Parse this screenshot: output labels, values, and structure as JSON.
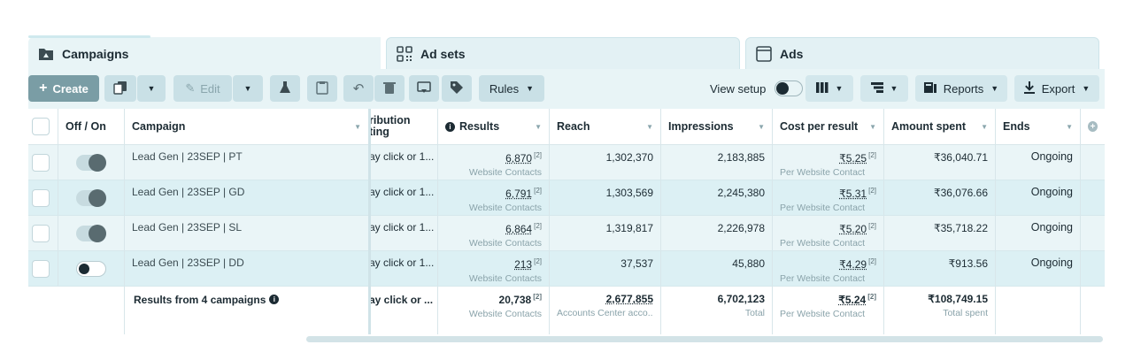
{
  "tabs": [
    {
      "label": "Campaigns",
      "icon": "folder-icon"
    },
    {
      "label": "Ad sets",
      "icon": "grid-icon"
    },
    {
      "label": "Ads",
      "icon": "window-icon"
    }
  ],
  "toolbar": {
    "create_label": "Create",
    "edit_label": "Edit",
    "rules_label": "Rules",
    "view_setup_label": "View setup",
    "reports_label": "Reports",
    "export_label": "Export"
  },
  "columns": {
    "off_on": "Off / On",
    "campaign": "Campaign",
    "attribution": "ribution\nting",
    "results": "Results",
    "reach": "Reach",
    "impressions": "Impressions",
    "cost_per_result": "Cost per result",
    "amount_spent": "Amount spent",
    "ends": "Ends"
  },
  "rows": [
    {
      "on": true,
      "campaign": "Lead Gen | 23SEP | PT",
      "attribution": "ay click or 1...",
      "results": "6,870",
      "results_sub": "Website Contacts",
      "reach": "1,302,370",
      "impressions": "2,183,885",
      "cpr": "₹5.25",
      "cpr_sub": "Per Website Contact",
      "spent": "₹36,040.71",
      "ends": "Ongoing"
    },
    {
      "on": true,
      "campaign": "Lead Gen | 23SEP | GD",
      "attribution": "ay click or 1...",
      "results": "6,791",
      "results_sub": "Website Contacts",
      "reach": "1,303,569",
      "impressions": "2,245,380",
      "cpr": "₹5.31",
      "cpr_sub": "Per Website Contact",
      "spent": "₹36,076.66",
      "ends": "Ongoing"
    },
    {
      "on": true,
      "campaign": "Lead Gen | 23SEP | SL",
      "attribution": "ay click or 1...",
      "results": "6,864",
      "results_sub": "Website Contacts",
      "reach": "1,319,817",
      "impressions": "2,226,978",
      "cpr": "₹5.20",
      "cpr_sub": "Per Website Contact",
      "spent": "₹35,718.22",
      "ends": "Ongoing"
    },
    {
      "on": false,
      "campaign": "Lead Gen | 23SEP | DD",
      "attribution": "ay click or 1...",
      "results": "213",
      "results_sub": "Website Contacts",
      "reach": "37,537",
      "impressions": "45,880",
      "cpr": "₹4.29",
      "cpr_sub": "Per Website Contact",
      "spent": "₹913.56",
      "ends": "Ongoing"
    }
  ],
  "footnote_marker": "[2]",
  "totals": {
    "label": "Results from 4 campaigns",
    "attribution": "ay click or ...",
    "results": "20,738",
    "results_sub": "Website Contacts",
    "reach": "2,677,855",
    "reach_sub": "Accounts Center acco...",
    "impressions": "6,702,123",
    "impressions_sub": "Total",
    "cpr": "₹5.24",
    "cpr_sub": "Per Website Contact",
    "spent": "₹108,749.15",
    "spent_sub": "Total spent"
  },
  "colors": {
    "accent": "#7a9da5",
    "panel": "#e8f4f6",
    "row_alt": "#dcf0f4"
  }
}
